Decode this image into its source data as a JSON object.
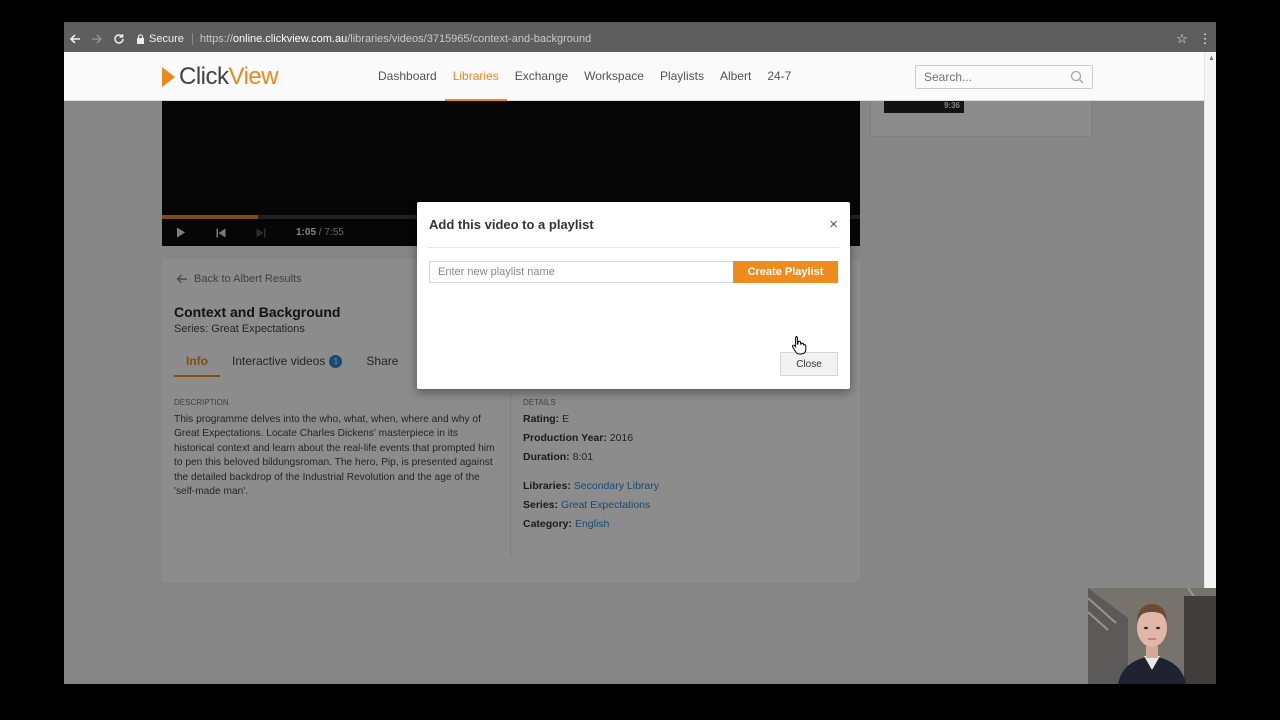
{
  "browser": {
    "secure_label": "Secure",
    "url_scheme": "https://",
    "url_host": "online.clickview.com.au",
    "url_path": "/libraries/videos/3715965/context-and-background"
  },
  "header": {
    "logo_text_a": "Click",
    "logo_text_b": "View",
    "nav": [
      {
        "label": "Dashboard"
      },
      {
        "label": "Libraries",
        "active": true
      },
      {
        "label": "Exchange"
      },
      {
        "label": "Workspace"
      },
      {
        "label": "Playlists"
      },
      {
        "label": "Albert"
      },
      {
        "label": "24-7"
      }
    ],
    "search_placeholder": "Search..."
  },
  "player": {
    "current_time": "1:05",
    "separator": "/",
    "total_time": "7:55",
    "progress_fraction": 0.137
  },
  "side": {
    "thumb_duration": "9:36"
  },
  "info": {
    "back_label": "Back to Albert Results",
    "title": "Context and Background",
    "series": "Series: Great Expectations",
    "tabs": {
      "info": "Info",
      "interactive": "Interactive videos",
      "interactive_badge": "1",
      "share": "Share"
    },
    "description_label": "DESCRIPTION",
    "description": "This programme delves into the who, what, when, where and why of Great Expectations. Locate Charles Dickens' masterpiece in its historical context and learn about the real-life events that prompted him to pen this beloved bildungsroman. The hero, Pip, is presented against the detailed backdrop of the Industrial Revolution and the age of the 'self-made man'.",
    "details_label": "DETAILS",
    "rating_label": "Rating:",
    "rating_value": "E",
    "year_label": "Production Year:",
    "year_value": "2016",
    "duration_label": "Duration:",
    "duration_value": "8:01",
    "libraries_label": "Libraries:",
    "libraries_value": "Secondary Library",
    "series_label": "Series:",
    "series_value": "Great Expectations",
    "category_label": "Category:",
    "category_value": "English"
  },
  "modal": {
    "title": "Add this video to a playlist",
    "input_placeholder": "Enter new playlist name",
    "create_label": "Create Playlist",
    "close_label": "Close",
    "close_x": "×"
  },
  "colors": {
    "accent": "#f08c1d",
    "link": "#2f87d0"
  }
}
